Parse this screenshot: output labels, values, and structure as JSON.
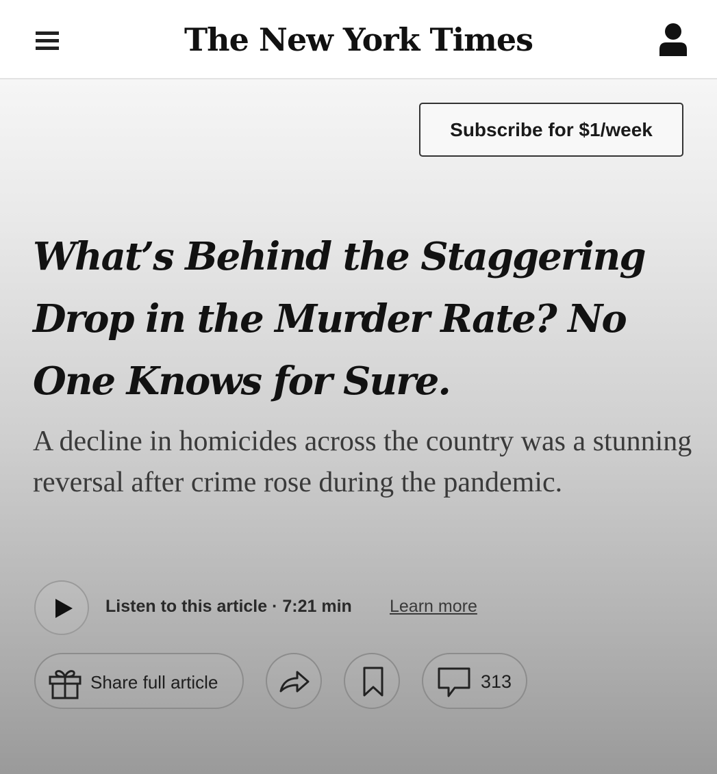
{
  "header": {
    "logo_text": "The New York Times",
    "menu_icon": "hamburger-menu-icon",
    "account_icon": "user-account-icon"
  },
  "subscribe": {
    "label": "Subscribe for $1/week"
  },
  "article": {
    "headline": "What’s Behind the Staggering Drop in the Murder Rate? No One Knows for Sure.",
    "dek": "A decline in homicides across the country was a stunning reversal after crime rose during the pandemic."
  },
  "audio": {
    "play_icon": "play-icon",
    "listen_label": "Listen to this article · 7:21 min",
    "learn_more": "Learn more"
  },
  "actions": {
    "share_full_label": "Share full article",
    "share_icon": "share-arrow-icon",
    "save_icon": "bookmark-icon",
    "comments_icon": "comment-bubble-icon",
    "comment_count": "313"
  },
  "colors": {
    "text": "#121212",
    "border": "#333333"
  }
}
